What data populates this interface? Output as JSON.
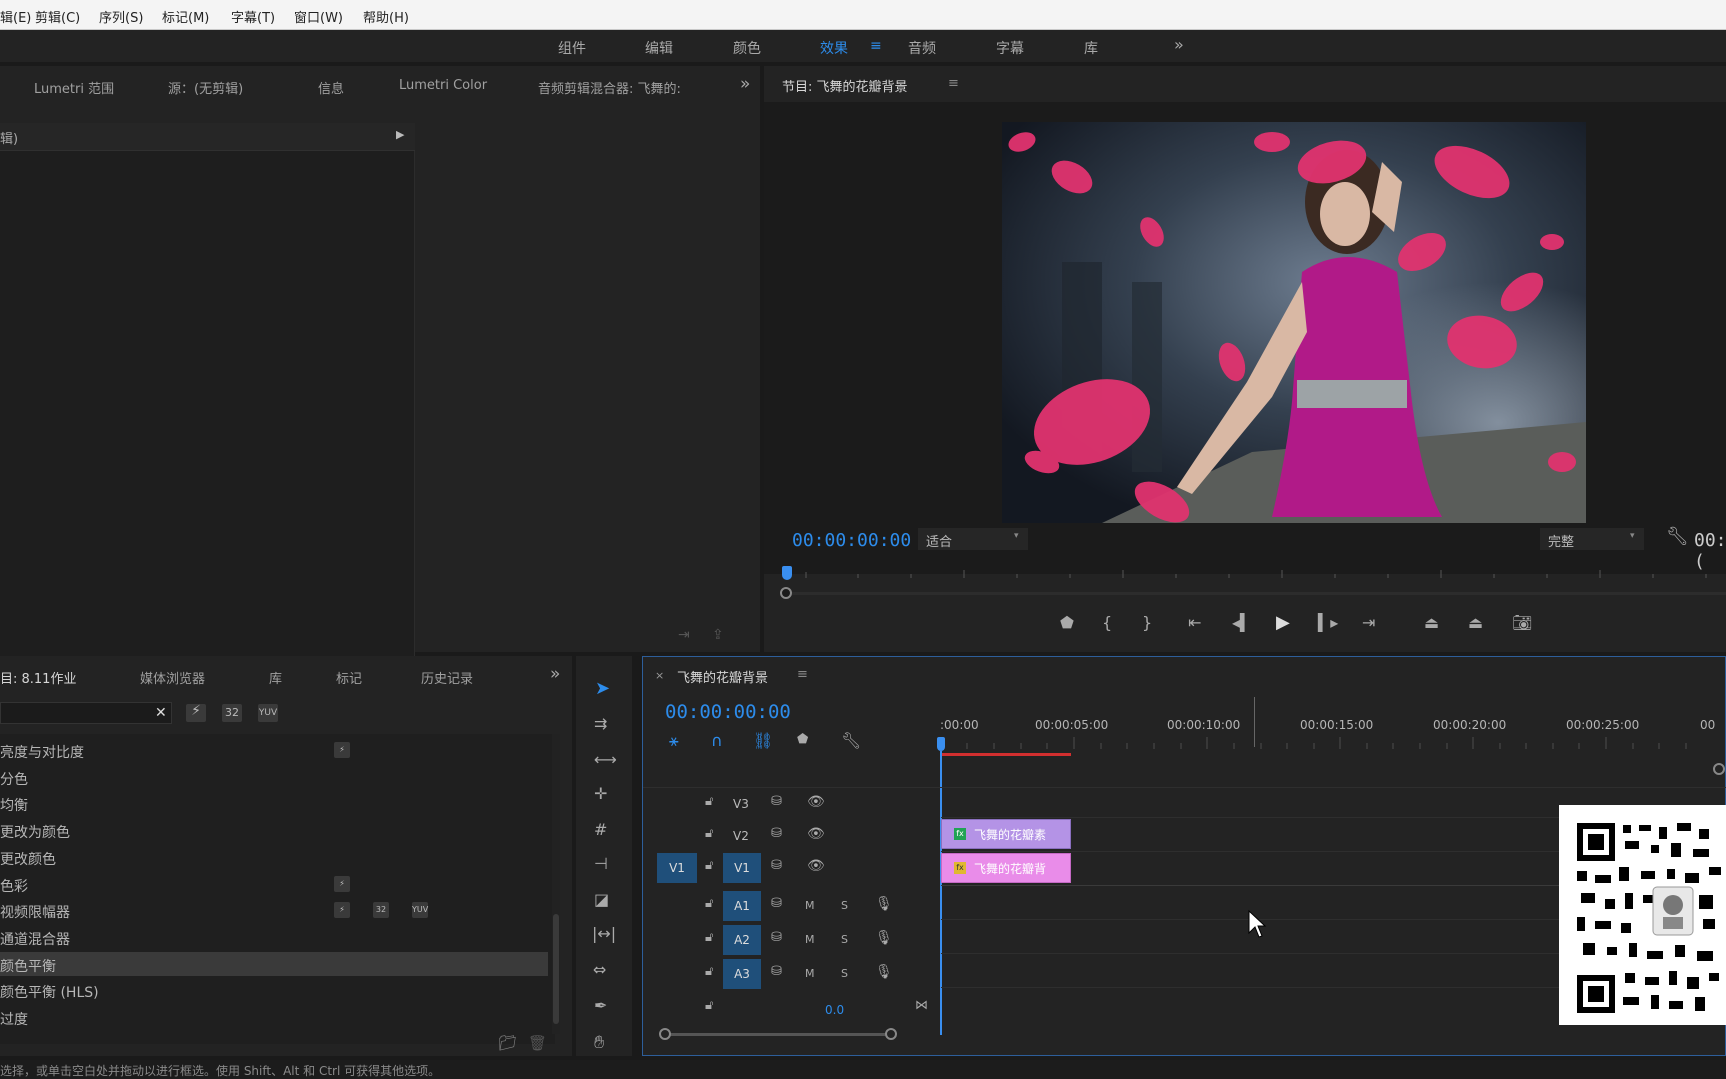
{
  "menu": [
    "辑(E)",
    "剪辑(C)",
    "序列(S)",
    "标记(M)",
    "字幕(T)",
    "窗口(W)",
    "帮助(H)"
  ],
  "workspaces": [
    "组件",
    "编辑",
    "颜色",
    "效果",
    "音频",
    "字幕",
    "库"
  ],
  "active_workspace_menu": "≡",
  "source_panel": {
    "tabs": [
      "Lumetri 范围",
      "源：(无剪辑)",
      "信息",
      "Lumetri Color",
      "音频剪辑混合器: 飞舞的:"
    ],
    "dropdown_text": "辑)"
  },
  "program_panel": {
    "title": "节目: 飞舞的花瓣背景",
    "timecode": "00:00:00:00",
    "fit_label": "适合",
    "quality_label": "完整",
    "end_timecode": "00:("
  },
  "project_panel": {
    "tabs": [
      "目: 8.11作业",
      "媒体浏览器",
      "库",
      "标记",
      "历史记录"
    ],
    "search_value": "",
    "effects": [
      "亮度与对比度",
      "分色",
      "均衡",
      "更改为颜色",
      "更改颜色",
      "色彩",
      "视频限幅器",
      "通道混合器",
      "颜色平衡",
      "颜色平衡 (HLS)",
      "过度"
    ],
    "selected_effect_index": 8
  },
  "timeline": {
    "sequence_name": "飞舞的花瓣背景",
    "timecode": "00:00:00:00",
    "ruler_labels": [
      ":00:00",
      "00:00:05:00",
      "00:00:10:00",
      "00:00:15:00",
      "00:00:20:00",
      "00:00:25:00",
      "00"
    ],
    "video_tracks": [
      "V3",
      "V2",
      "V1"
    ],
    "audio_tracks": [
      "A1",
      "A2",
      "A3"
    ],
    "source_patch": "V1",
    "mute_label": "M",
    "solo_label": "S",
    "master_volume": "0.0",
    "clips": [
      {
        "track": "V2",
        "label": "飞舞的花瓣素"
      },
      {
        "track": "V1",
        "label": "飞舞的花瓣背"
      }
    ]
  },
  "status_bar": "选择，或单击空白处并拖动以进行框选。使用 Shift、Alt 和 Ctrl 可获得其他选项。",
  "colors": {
    "accent": "#2d8ceb",
    "clip_v2": "#b493e6",
    "clip_v1": "#e98ce9",
    "playhead": "#3a8ff0",
    "work_area": "#d22f2f"
  }
}
